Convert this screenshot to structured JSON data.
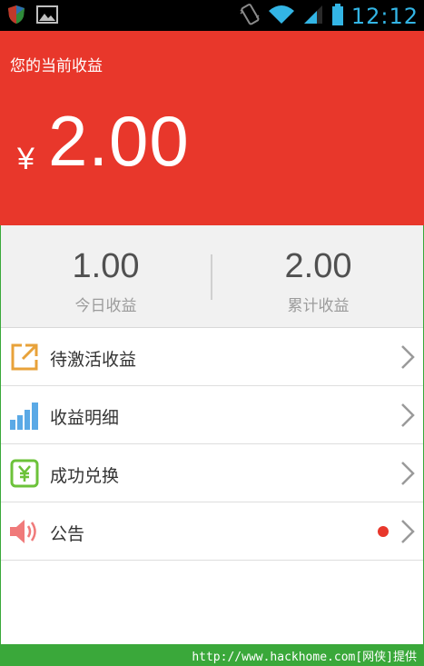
{
  "status_bar": {
    "time": "12:12",
    "icons": [
      "shield-icon",
      "image-icon",
      "vibrate-icon",
      "wifi-icon",
      "signal-icon",
      "battery-icon"
    ]
  },
  "header": {
    "title": "您的当前收益",
    "currency_symbol": "¥",
    "amount": "2.00",
    "background": "#e8372b"
  },
  "stats": {
    "today": {
      "value": "1.00",
      "label": "今日收益"
    },
    "total": {
      "value": "2.00",
      "label": "累计收益"
    }
  },
  "menu": {
    "items": [
      {
        "label": "待激活收益",
        "icon": "external-link-icon",
        "has_dot": false
      },
      {
        "label": "收益明细",
        "icon": "bar-chart-icon",
        "has_dot": false
      },
      {
        "label": "成功兑换",
        "icon": "yen-card-icon",
        "has_dot": false
      },
      {
        "label": "公告",
        "icon": "speaker-icon",
        "has_dot": true
      }
    ]
  },
  "footer": {
    "watermark": "http://www.hackhome.com[网侠]提供"
  },
  "colors": {
    "accent_red": "#e8372b",
    "status_blue": "#33b5e5",
    "watermark_green": "#3aa83a"
  }
}
